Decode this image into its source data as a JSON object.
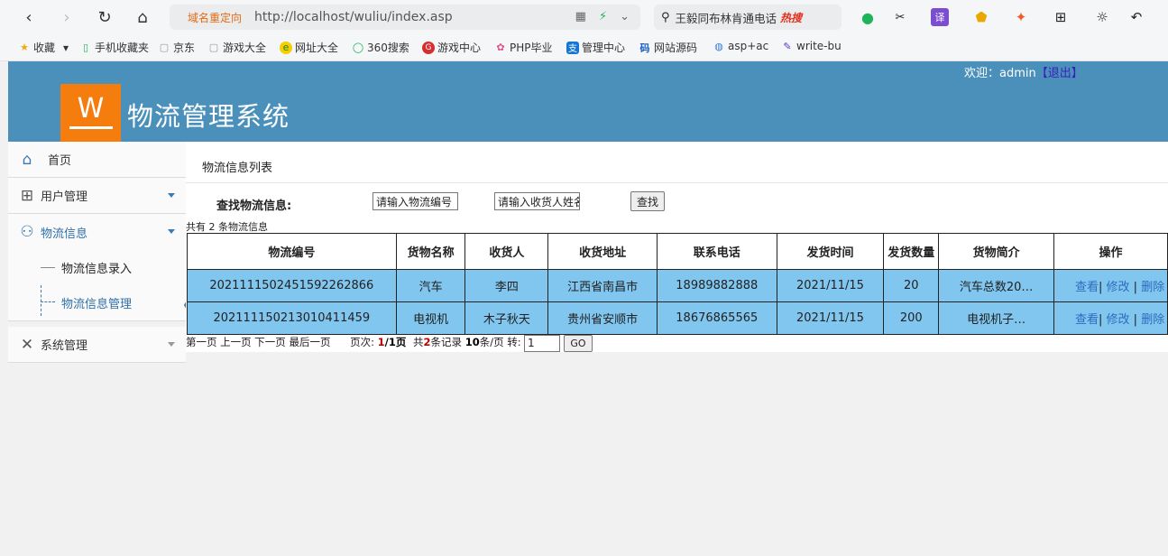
{
  "browser": {
    "url_redirect_label": "域名重定向",
    "url": "http://localhost/wuliu/index.asp",
    "search_text": "王毅同布林肯通电话",
    "search_hot": "热搜",
    "bookmarks": [
      "收藏",
      "手机收藏夹",
      "京东",
      "游戏大全",
      "网址大全",
      "360搜索",
      "游戏中心",
      "PHP毕业",
      "管理中心",
      "网站源码",
      "asp+ac",
      "write-bu"
    ]
  },
  "header": {
    "logo_letter": "W",
    "title": "物流管理系统",
    "welcome": "欢迎：admin",
    "logout": "【退出】"
  },
  "sidebar": {
    "home": "首页",
    "user_mgmt": "用户管理",
    "logistics": "物流信息",
    "sub_entry": "物流信息录入",
    "sub_manage": "物流信息管理",
    "system_mgmt": "系统管理"
  },
  "main": {
    "title": "物流信息列表",
    "search_label": "查找物流信息:",
    "input_no_value": "请输入物流编号",
    "input_name_value": "请输入收货人姓名",
    "search_button": "查找",
    "count_text": "共有 2 条物流信息",
    "table": {
      "headers": [
        "物流编号",
        "货物名称",
        "收货人",
        "收货地址",
        "联系电话",
        "发货时间",
        "发货数量",
        "货物简介",
        "操作"
      ],
      "rows": [
        [
          "2021111502451592262866",
          "汽车",
          "李四",
          "江西省南昌市",
          "18989882888",
          "2021/11/15",
          "20",
          "汽车总数20…"
        ],
        [
          "202111150213010411459",
          "电视机",
          "木子秋天",
          "贵州省安顺市",
          "18676865565",
          "2021/11/15",
          "200",
          "电视机子…"
        ]
      ],
      "action_view": "查看",
      "action_edit": "修改",
      "action_delete": "删除"
    },
    "pager": {
      "nav": "第一页 上一页 下一页 最后一页",
      "page_label": "页次:",
      "page_current": "1",
      "page_total": "/1页",
      "record_prefix": "共",
      "record_count": "2",
      "record_suffix": "条记录",
      "per_page": "10",
      "per_page_suffix": "条/页 转:",
      "goto_value": "1",
      "go_button": "GO"
    }
  }
}
